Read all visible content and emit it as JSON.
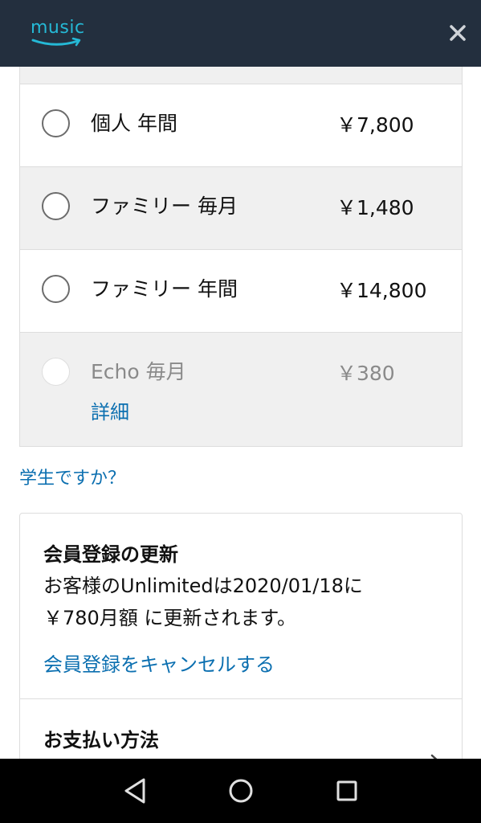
{
  "header": {
    "logo_text": "music",
    "logo_color": "#25b9d6",
    "background": "#232f3e",
    "close_icon": "close-icon"
  },
  "plans": [
    {
      "name": "個人 年間",
      "price": "￥7,800",
      "enabled": true
    },
    {
      "name": "ファミリー 毎月",
      "price": "￥1,480",
      "enabled": true
    },
    {
      "name": "ファミリー 年間",
      "price": "￥14,800",
      "enabled": true
    },
    {
      "name": "Echo 毎月",
      "price": "￥380",
      "enabled": false,
      "details_link": "詳細"
    }
  ],
  "student_link": "学生ですか？",
  "membership": {
    "title": "会員登録の更新",
    "renewal_line1": "お客様のUnlimitedは2020/01/18に",
    "renewal_line2": "￥780月額 に更新されます。",
    "cancel_link": "会員登録をキャンセルする"
  },
  "payment": {
    "title": "お支払い方法"
  },
  "nav_bar": {
    "back_icon": "back-triangle-icon",
    "home_icon": "home-circle-icon",
    "recents_icon": "recents-square-icon"
  },
  "colors": {
    "link": "#0b6fb0",
    "row_shaded": "#f0f0f0"
  }
}
